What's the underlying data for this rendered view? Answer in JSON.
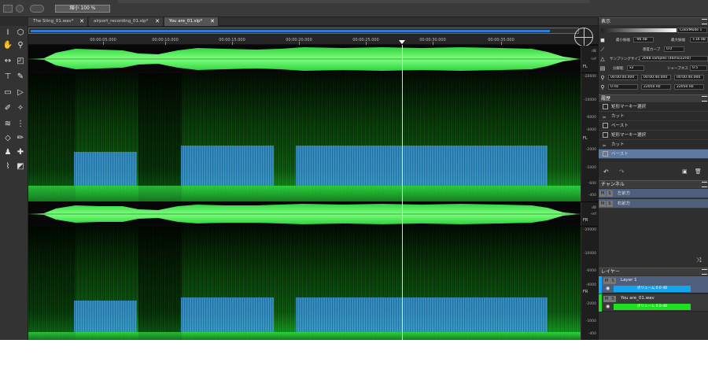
{
  "toolbar_top": {
    "zoom": "縮小 100 %"
  },
  "tabs": [
    {
      "label": "The Sting_01.wav*",
      "close": "✕"
    },
    {
      "label": "airport_recording_01.slp*",
      "close": "✕"
    },
    {
      "label": "You are_01.slp*",
      "close": "✕"
    }
  ],
  "ruler": {
    "times": [
      "00:00:05.000",
      "00:00:10.000",
      "00:00:15.000",
      "00:00:20.000",
      "00:00:25.000",
      "00:00:30.000",
      "00:00:35.000"
    ]
  },
  "channels": {
    "wave_scale": [
      "dB",
      "-inf"
    ],
    "freq_scale": [
      "-20000",
      "-10000",
      "-6000",
      "-4000",
      "-2000",
      "-1000",
      "-600",
      "-400"
    ],
    "fl": "FL",
    "fr": "FR"
  },
  "display_panel": {
    "title": "表示",
    "min_level_label": "最小振幅",
    "min_level": "-96 dB",
    "max_level_label": "最大振幅",
    "max_level": "+16 dB",
    "curve_label": "感度カーブ",
    "curve": "0.0",
    "sample_label": "サンプリングサイズ",
    "sample": "2048 samples (46ms/22Hz)",
    "res_label": "分解能",
    "res": "x2",
    "sharp_label": "シャープネス",
    "sharp": "0.5",
    "time_start": "00:00:00.000",
    "time_end": "00:00:40.000",
    "time_len": "00:00:40.000",
    "freq_start": "0 Hz",
    "freq_end": "22050 Hz",
    "freq_len": "22050 Hz",
    "colormap": "ColorMode 1"
  },
  "history_panel": {
    "title": "履歴",
    "items": [
      "矩形マーキー選択",
      "カット",
      "ペースト",
      "矩形マーキー選択",
      "カット",
      "ペースト"
    ],
    "selected_index": 5
  },
  "channel_panel": {
    "title": "チャンネル",
    "items": [
      {
        "m": "M",
        "s": "S",
        "label": "左前方"
      },
      {
        "m": "M",
        "s": "S",
        "label": "右前方"
      }
    ]
  },
  "layer_panel": {
    "title": "レイヤー",
    "layers": [
      {
        "name": "Layer 1",
        "volume": "ボリューム 0.0 dB",
        "color": "#12a6f0"
      },
      {
        "name": "You are_01.wav",
        "volume": "ボリューム 0.0 dB",
        "color": "#1ee01e"
      }
    ]
  }
}
